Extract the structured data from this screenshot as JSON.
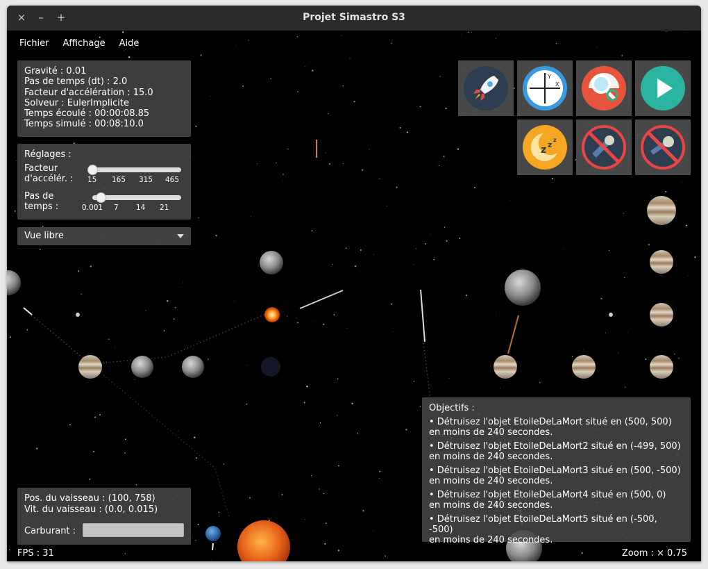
{
  "window": {
    "title": "Projet Simastro S3",
    "close": "×",
    "minimize": "–",
    "maximize": "+"
  },
  "menu": [
    "Fichier",
    "Affichage",
    "Aide"
  ],
  "info": {
    "gravity": "Gravité : 0.01",
    "dt": "Pas de temps (dt) : 2.0",
    "accel": "Facteur d'accélération : 15.0",
    "solver": "Solveur : EulerImplicite",
    "elapsed": "Temps écoulé : 00:00:08.85",
    "simulated": "Temps simulé : 00:08:10.0"
  },
  "settings": {
    "title": "Réglages :",
    "accel_label_1": "Facteur",
    "accel_label_2": "d'accélér. :",
    "accel_ticks": [
      "15",
      "165",
      "315",
      "465"
    ],
    "accel_value": 15,
    "dt_label_1": "Pas de",
    "dt_label_2": "temps :",
    "dt_ticks": [
      "0.001",
      "7",
      "14",
      "21"
    ],
    "dt_value": 2.0
  },
  "view_select": {
    "value": "Vue libre"
  },
  "toolbar": [
    {
      "name": "rocket-button",
      "icon": "rocket-icon"
    },
    {
      "name": "axes-button",
      "icon": "axes-icon"
    },
    {
      "name": "search-button",
      "icon": "magnifier-icon"
    },
    {
      "name": "play-button",
      "icon": "play-icon"
    },
    {
      "name": "sleep-button",
      "icon": "moon-zzz-icon"
    },
    {
      "name": "no-comets-button",
      "icon": "no-comet-icon"
    },
    {
      "name": "no-asteroids-button",
      "icon": "no-asteroid-icon"
    }
  ],
  "ship": {
    "pos": "Pos. du vaisseau : (100, 758)",
    "vel": "Vit. du vaisseau : (0.0, 0.015)",
    "fuel_label": "Carburant :"
  },
  "objectives": {
    "title": "Objectifs :",
    "items": [
      {
        "line1": "• Détruisez l'objet EtoileDeLaMort situé en (500, 500)",
        "line2": "en moins de 240 secondes."
      },
      {
        "line1": "• Détruisez l'objet EtoileDeLaMort2 situé en (-499, 500)",
        "line2": "en moins de 240 secondes."
      },
      {
        "line1": "• Détruisez l'objet EtoileDeLaMort3 situé en (500, -500)",
        "line2": "en moins de 240 secondes."
      },
      {
        "line1": "• Détruisez l'objet EtoileDeLaMort4 situé en (500, 0)",
        "line2": "en moins de 240 secondes."
      },
      {
        "line1": "• Détruisez l'objet EtoileDeLaMort5 situé en (-500, -500)",
        "line2": "en moins de 240 secondes."
      }
    ]
  },
  "status": {
    "fps": "FPS : 31",
    "zoom": "Zoom : × 0.75"
  },
  "colors": {
    "panel": "#464646",
    "accent_play": "#2bb5a0",
    "moon": "#f5a623",
    "forbid": "#e84545",
    "sun": "#e8641b"
  }
}
